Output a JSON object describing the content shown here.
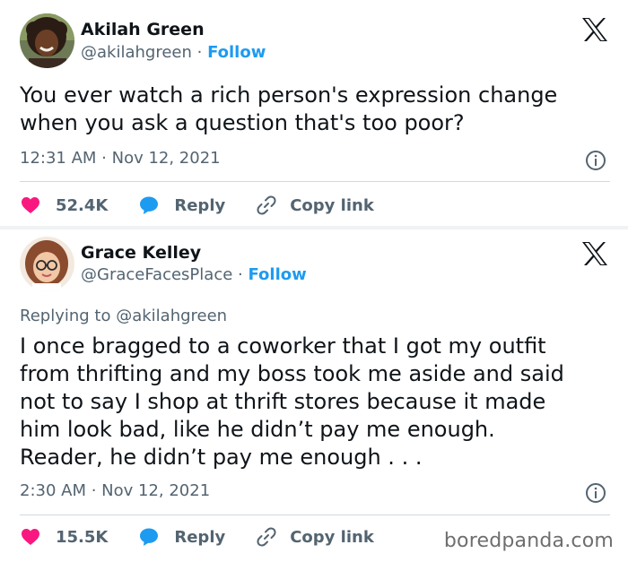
{
  "tweets": [
    {
      "author_name": "Akilah Green",
      "handle": "@akilahgreen",
      "separator": " · ",
      "follow_label": "Follow",
      "text": "You ever watch a rich person's expression change\nwhen you ask a question that's too poor?",
      "timestamp": "12:31 AM · Nov 12, 2021",
      "likes": "52.4K",
      "reply_label": "Reply",
      "copy_label": "Copy link"
    },
    {
      "author_name": "Grace Kelley",
      "handle": "@GraceFacesPlace",
      "separator": " · ",
      "follow_label": "Follow",
      "replying_prefix": "Replying to ",
      "replying_to": "@akilahgreen",
      "text": "I once bragged to a coworker that I got my outfit\nfrom thrifting and my boss took me aside and said\nnot to say I shop at thrift stores because it made\nhim look bad, like he didn’t pay me enough.\nReader, he didn’t pay me enough . . .",
      "timestamp": "2:30 AM · Nov 12, 2021",
      "likes": "15.5K",
      "reply_label": "Reply",
      "copy_label": "Copy link"
    }
  ],
  "watermark": "boredpanda.com",
  "colors": {
    "link": "#1d9bf0",
    "heart": "#f91880",
    "muted": "#536471",
    "text": "#0f1419"
  },
  "icons": [
    "x-logo-icon",
    "info-icon",
    "heart-icon",
    "reply-bubble-icon",
    "link-icon"
  ]
}
